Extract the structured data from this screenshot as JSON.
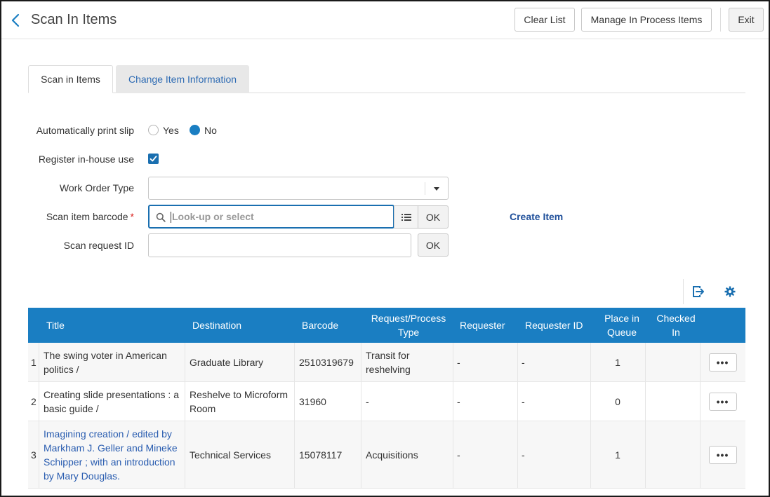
{
  "header": {
    "title": "Scan In Items",
    "clear_list": "Clear List",
    "manage_in_process": "Manage In Process Items",
    "exit": "Exit"
  },
  "tabs": [
    {
      "label": "Scan in Items",
      "active": true
    },
    {
      "label": "Change Item Information",
      "active": false
    }
  ],
  "form": {
    "auto_print_label": "Automatically print slip",
    "auto_print_yes": "Yes",
    "auto_print_no": "No",
    "auto_print_selected": "No",
    "register_label": "Register in-house use",
    "register_checked": true,
    "work_order_label": "Work Order Type",
    "work_order_value": "",
    "barcode_label": "Scan item barcode",
    "barcode_required": "*",
    "barcode_placeholder": "Look-up or select",
    "barcode_ok": "OK",
    "create_item": "Create Item",
    "request_label": "Scan request ID",
    "request_value": "",
    "request_ok": "OK"
  },
  "colors": {
    "accent": "#1a7ec2",
    "link": "#2a5db0",
    "required": "#d9201c"
  },
  "icons": [
    "chevron-left-icon",
    "search-icon",
    "list-icon",
    "export-icon",
    "gear-icon",
    "ellipsis-icon"
  ],
  "table": {
    "headers": [
      "Title",
      "Destination",
      "Barcode",
      "Request/Process Type",
      "Requester",
      "Requester ID",
      "Place in Queue",
      "Checked In"
    ],
    "rows": [
      {
        "num": "1",
        "title": "The swing voter in American politics /",
        "title_link": false,
        "destination": "Graduate Library",
        "barcode": "2510319679",
        "request_type": "Transit for reshelving",
        "requester": "-",
        "requester_id": "-",
        "place_in_queue": "1",
        "checked_in": "",
        "action": "•••"
      },
      {
        "num": "2",
        "title": "Creating slide presentations : a basic guide /",
        "title_link": false,
        "destination": "Reshelve to Microform Room",
        "barcode": "31960",
        "request_type": "-",
        "requester": "-",
        "requester_id": "-",
        "place_in_queue": "0",
        "checked_in": "",
        "action": "•••"
      },
      {
        "num": "3",
        "title": "Imagining creation / edited by Markham J. Geller and Mineke Schipper ; with an introduction by Mary Douglas.",
        "title_link": true,
        "destination": "Technical Services",
        "barcode": "15078117",
        "request_type": "Acquisitions",
        "requester": "-",
        "requester_id": "-",
        "place_in_queue": "1",
        "checked_in": "",
        "action": "•••"
      }
    ]
  }
}
